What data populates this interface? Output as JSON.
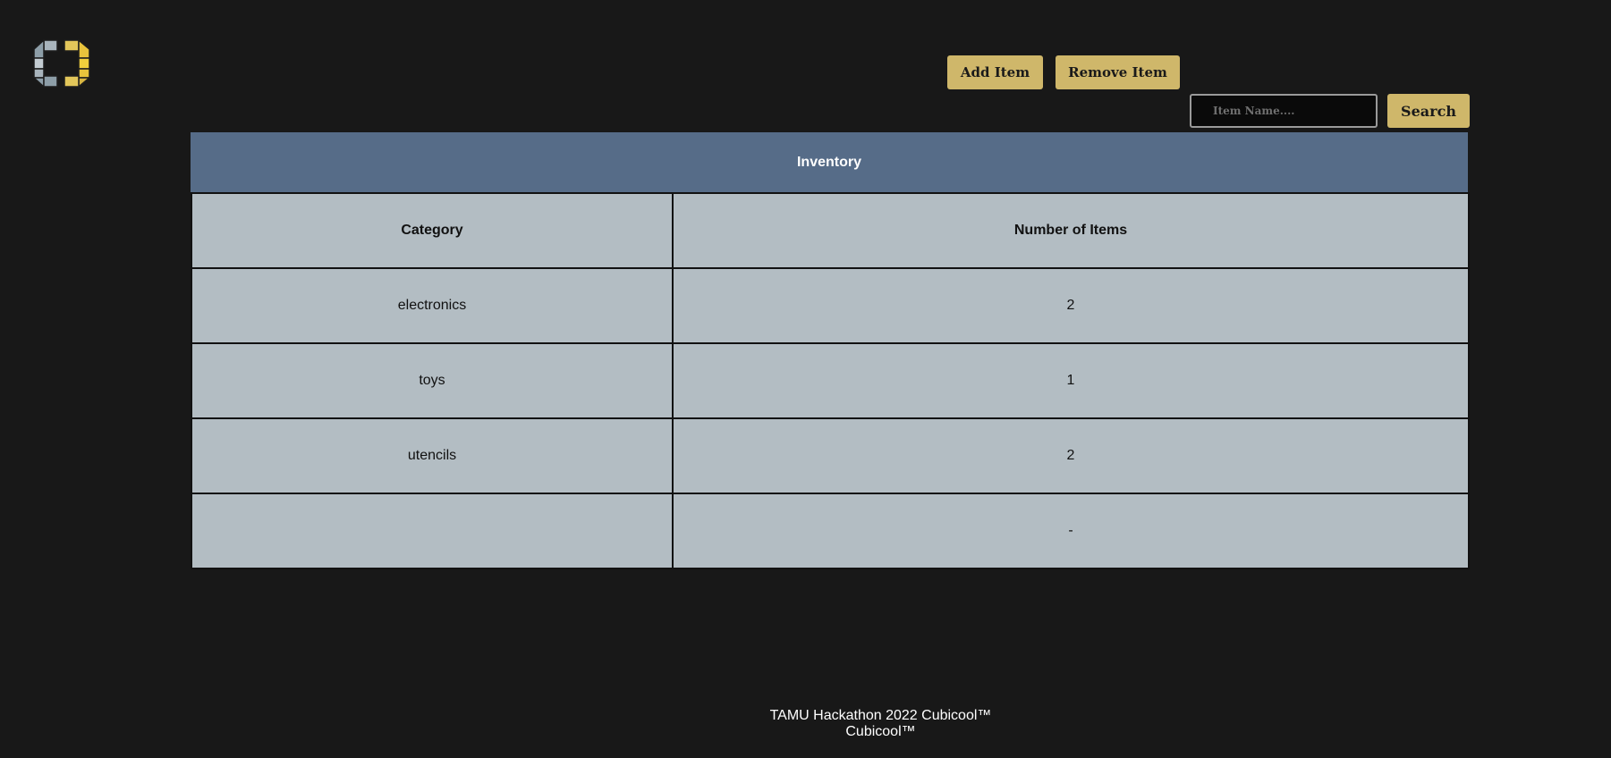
{
  "logo": {
    "icon": "cube-logo-icon",
    "colors": [
      "#8d9ea8",
      "#e8c33c"
    ]
  },
  "toolbar": {
    "add_label": "Add Item",
    "remove_label": "Remove Item"
  },
  "search": {
    "placeholder": "Item Name....",
    "value": "",
    "button_label": "Search"
  },
  "inventory": {
    "title": "Inventory",
    "columns": [
      "Category",
      "Number of Items"
    ],
    "rows": [
      {
        "category": "electronics",
        "count": "2"
      },
      {
        "category": "toys",
        "count": "1"
      },
      {
        "category": "utencils",
        "count": "2"
      },
      {
        "category": "",
        "count": "-"
      }
    ]
  },
  "footer": {
    "line1": "TAMU Hackathon 2022 Cubicool™",
    "line2": "Cubicool™"
  },
  "colors": {
    "background": "#181818",
    "button": "#cfb76a",
    "table_header": "#566c88",
    "table_cell": "#b3bdc3"
  }
}
